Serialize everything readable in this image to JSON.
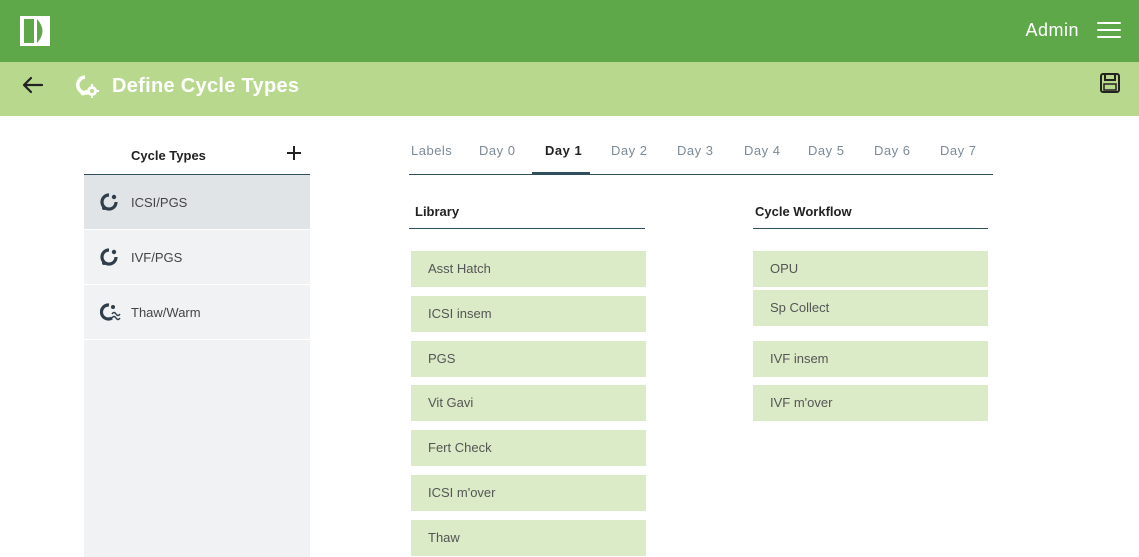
{
  "header": {
    "user_name": "Admin",
    "bar_color": "#5fa84a",
    "subbar_color": "#b8d98d",
    "page_title": "Define Cycle Types"
  },
  "sidebar": {
    "title": "Cycle Types",
    "items": [
      {
        "label": "ICSI/PGS",
        "icon": "cycle-icon",
        "selected": true
      },
      {
        "label": "IVF/PGS",
        "icon": "cycle-icon",
        "selected": false
      },
      {
        "label": "Thaw/Warm",
        "icon": "cycle-thaw-icon",
        "selected": false
      }
    ]
  },
  "tabs": {
    "items": [
      "Labels",
      "Day 0",
      "Day 1",
      "Day 2",
      "Day 3",
      "Day 4",
      "Day 5",
      "Day 6",
      "Day 7"
    ],
    "active": "Day 1"
  },
  "library": {
    "title": "Library",
    "items": [
      "Asst Hatch",
      "ICSI insem",
      "PGS",
      "Vit Gavi",
      "Fert Check",
      "ICSI m'over",
      "Thaw"
    ],
    "block_color": "#dbeac7"
  },
  "workflow": {
    "title": "Cycle Workflow",
    "items": [
      "OPU",
      "Sp Collect",
      "IVF insem",
      "IVF m'over"
    ]
  }
}
